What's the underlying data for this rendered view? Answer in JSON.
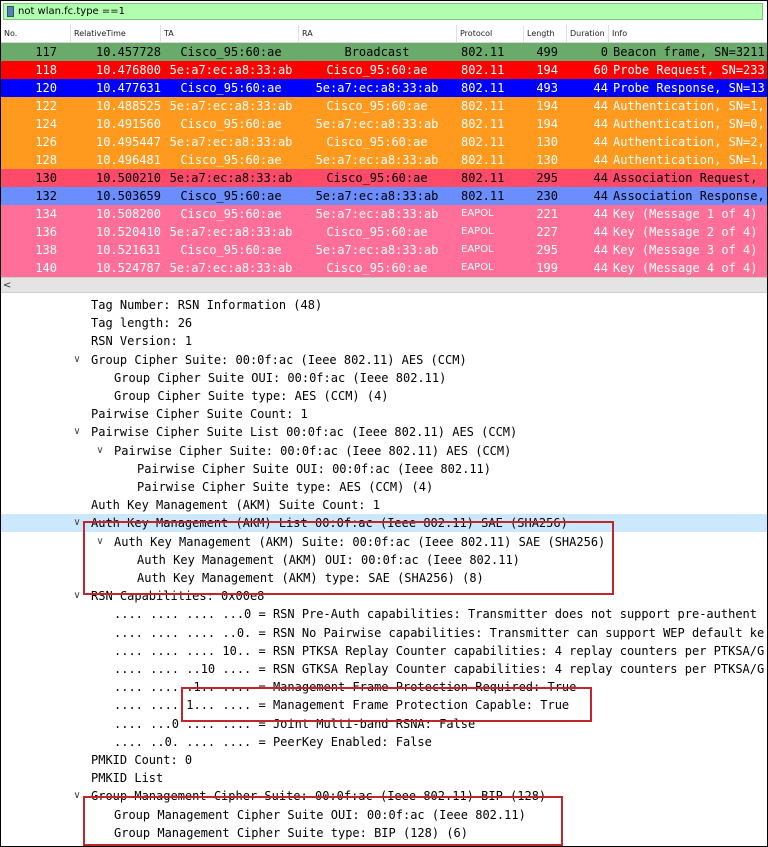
{
  "filter": {
    "text": "not wlan.fc.type ==1"
  },
  "columns": [
    "No.",
    "RelativeTime",
    "TA",
    "RA",
    "Protocol",
    "Length",
    "Duration",
    "Info"
  ],
  "packets": [
    {
      "no": "117",
      "time": "10.457728",
      "ta": "Cisco_95:60:ae",
      "ra": "Broadcast",
      "protocol": "802.11",
      "length": "499",
      "duration": "0",
      "info": "Beacon frame, SN=3211,",
      "bg": "#6aaa6a",
      "fg": "#000000"
    },
    {
      "no": "118",
      "time": "10.476800",
      "ta": "5e:a7:ec:a8:33:ab",
      "ra": "Cisco_95:60:ae",
      "protocol": "802.11",
      "length": "194",
      "duration": "60",
      "info": "Probe Request, SN=233",
      "bg": "#ff0000",
      "fg": "#ffffff"
    },
    {
      "no": "120",
      "time": "10.477631",
      "ta": "Cisco_95:60:ae",
      "ra": "5e:a7:ec:a8:33:ab",
      "protocol": "802.11",
      "length": "493",
      "duration": "44",
      "info": "Probe Response, SN=13",
      "bg": "#0000ff",
      "fg": "#ffffff"
    },
    {
      "no": "122",
      "time": "10.488525",
      "ta": "5e:a7:ec:a8:33:ab",
      "ra": "Cisco_95:60:ae",
      "protocol": "802.11",
      "length": "194",
      "duration": "44",
      "info": "Authentication, SN=1,",
      "bg": "#ff9a1e",
      "fg": "#ffffff"
    },
    {
      "no": "124",
      "time": "10.491560",
      "ta": "Cisco_95:60:ae",
      "ra": "5e:a7:ec:a8:33:ab",
      "protocol": "802.11",
      "length": "194",
      "duration": "44",
      "info": "Authentication, SN=0,",
      "bg": "#ff9a1e",
      "fg": "#ffffff"
    },
    {
      "no": "126",
      "time": "10.495447",
      "ta": "5e:a7:ec:a8:33:ab",
      "ra": "Cisco_95:60:ae",
      "protocol": "802.11",
      "length": "130",
      "duration": "44",
      "info": "Authentication, SN=2,",
      "bg": "#ff9a1e",
      "fg": "#ffffff"
    },
    {
      "no": "128",
      "time": "10.496481",
      "ta": "Cisco_95:60:ae",
      "ra": "5e:a7:ec:a8:33:ab",
      "protocol": "802.11",
      "length": "130",
      "duration": "44",
      "info": "Authentication, SN=1,",
      "bg": "#ff9a1e",
      "fg": "#ffffff"
    },
    {
      "no": "130",
      "time": "10.500210",
      "ta": "5e:a7:ec:a8:33:ab",
      "ra": "Cisco_95:60:ae",
      "protocol": "802.11",
      "length": "295",
      "duration": "44",
      "info": "Association Request,",
      "bg": "#ff4a6a",
      "fg": "#000000"
    },
    {
      "no": "132",
      "time": "10.503659",
      "ta": "Cisco_95:60:ae",
      "ra": "5e:a7:ec:a8:33:ab",
      "protocol": "802.11",
      "length": "230",
      "duration": "44",
      "info": "Association Response,",
      "bg": "#6a8eff",
      "fg": "#000000"
    },
    {
      "no": "134",
      "time": "10.508200",
      "ta": "Cisco_95:60:ae",
      "ra": "5e:a7:ec:a8:33:ab",
      "protocol": "EAPOL",
      "length": "221",
      "duration": "44",
      "info": "Key (Message 1 of 4)",
      "bg": "#ff6f99",
      "fg": "#ffffff"
    },
    {
      "no": "136",
      "time": "10.520410",
      "ta": "5e:a7:ec:a8:33:ab",
      "ra": "Cisco_95:60:ae",
      "protocol": "EAPOL",
      "length": "227",
      "duration": "44",
      "info": "Key (Message 2 of 4)",
      "bg": "#ff6f99",
      "fg": "#ffffff"
    },
    {
      "no": "138",
      "time": "10.521631",
      "ta": "Cisco_95:60:ae",
      "ra": "5e:a7:ec:a8:33:ab",
      "protocol": "EAPOL",
      "length": "295",
      "duration": "44",
      "info": "Key (Message 3 of 4)",
      "bg": "#ff6f99",
      "fg": "#ffffff"
    },
    {
      "no": "140",
      "time": "10.524787",
      "ta": "5e:a7:ec:a8:33:ab",
      "ra": "Cisco_95:60:ae",
      "protocol": "EAPOL",
      "length": "199",
      "duration": "44",
      "info": "Key (Message 4 of 4)",
      "bg": "#ff6f99",
      "fg": "#ffffff"
    }
  ],
  "tree": [
    {
      "indent": 0,
      "exp": "",
      "text": "Tag Number: RSN Information (48)"
    },
    {
      "indent": 0,
      "exp": "",
      "text": "Tag length: 26"
    },
    {
      "indent": 0,
      "exp": "",
      "text": "RSN Version: 1"
    },
    {
      "indent": 0,
      "exp": "open",
      "text": "Group Cipher Suite: 00:0f:ac (Ieee 802.11) AES (CCM)"
    },
    {
      "indent": 1,
      "exp": "",
      "text": "Group Cipher Suite OUI: 00:0f:ac (Ieee 802.11)"
    },
    {
      "indent": 1,
      "exp": "",
      "text": "Group Cipher Suite type: AES (CCM) (4)"
    },
    {
      "indent": 0,
      "exp": "",
      "text": "Pairwise Cipher Suite Count: 1"
    },
    {
      "indent": 0,
      "exp": "open",
      "text": "Pairwise Cipher Suite List 00:0f:ac (Ieee 802.11) AES (CCM)"
    },
    {
      "indent": 1,
      "exp": "open",
      "text": "Pairwise Cipher Suite: 00:0f:ac (Ieee 802.11) AES (CCM)"
    },
    {
      "indent": 2,
      "exp": "",
      "text": "Pairwise Cipher Suite OUI: 00:0f:ac (Ieee 802.11)"
    },
    {
      "indent": 2,
      "exp": "",
      "text": "Pairwise Cipher Suite type: AES (CCM) (4)"
    },
    {
      "indent": 0,
      "exp": "",
      "text": "Auth Key Management (AKM) Suite Count: 1"
    },
    {
      "indent": 0,
      "exp": "open",
      "text": "Auth Key Management (AKM) List 00:0f:ac (Ieee 802.11) SAE (SHA256)",
      "selected": true
    },
    {
      "indent": 1,
      "exp": "open",
      "text": "Auth Key Management (AKM) Suite: 00:0f:ac (Ieee 802.11) SAE (SHA256)"
    },
    {
      "indent": 2,
      "exp": "",
      "text": "Auth Key Management (AKM) OUI: 00:0f:ac (Ieee 802.11)"
    },
    {
      "indent": 2,
      "exp": "",
      "text": "Auth Key Management (AKM) type: SAE (SHA256) (8)"
    },
    {
      "indent": 0,
      "exp": "open",
      "text": "RSN Capabilities: 0x00e8"
    },
    {
      "indent": 1,
      "exp": "",
      "text": ".... .... .... ...0 = RSN Pre-Auth capabilities: Transmitter does not support pre-authent"
    },
    {
      "indent": 1,
      "exp": "",
      "text": ".... .... .... ..0. = RSN No Pairwise capabilities: Transmitter can support WEP default ke"
    },
    {
      "indent": 1,
      "exp": "",
      "text": ".... .... .... 10.. = RSN PTKSA Replay Counter capabilities: 4 replay counters per PTKSA/G"
    },
    {
      "indent": 1,
      "exp": "",
      "text": ".... .... ..10 .... = RSN GTKSA Replay Counter capabilities: 4 replay counters per PTKSA/G"
    },
    {
      "indent": 1,
      "exp": "",
      "text": ".... .... .1.. .... = Management Frame Protection Required: True"
    },
    {
      "indent": 1,
      "exp": "",
      "text": ".... .... 1... .... = Management Frame Protection Capable: True"
    },
    {
      "indent": 1,
      "exp": "",
      "text": ".... ...0 .... .... = Joint Multi-band RSNA: False"
    },
    {
      "indent": 1,
      "exp": "",
      "text": ".... ..0. .... .... = PeerKey Enabled: False"
    },
    {
      "indent": 0,
      "exp": "",
      "text": "PMKID Count: 0"
    },
    {
      "indent": 0,
      "exp": "",
      "text": "PMKID List"
    },
    {
      "indent": 0,
      "exp": "open",
      "text": "Group Management Cipher Suite: 00:0f:ac (Ieee 802.11) BIP (128)"
    },
    {
      "indent": 1,
      "exp": "",
      "text": "Group Management Cipher Suite OUI: 00:0f:ac (Ieee 802.11)"
    },
    {
      "indent": 1,
      "exp": "",
      "text": "Group Management Cipher Suite type: BIP (128) (6)"
    }
  ],
  "highlight_color": "#c0272d"
}
